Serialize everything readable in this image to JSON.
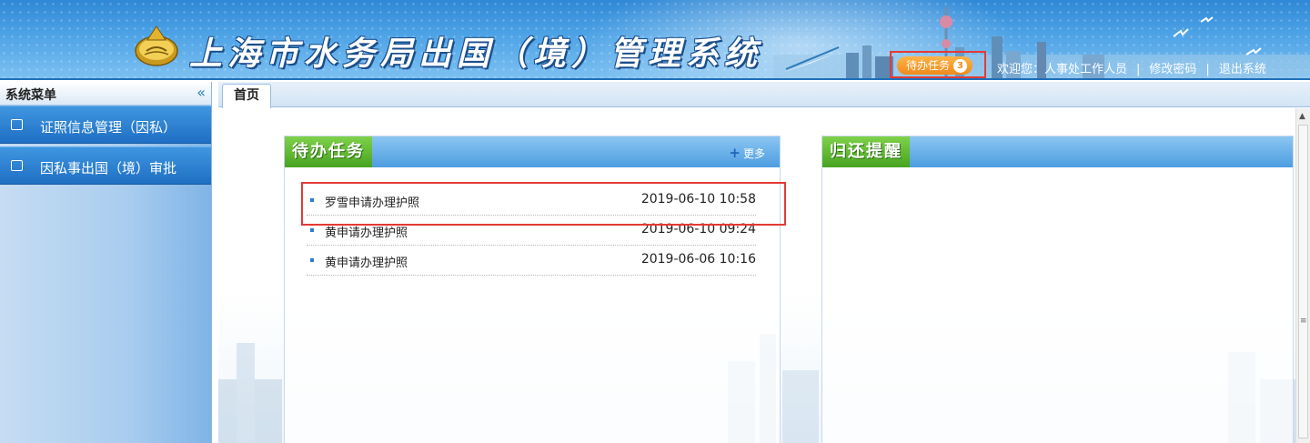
{
  "header": {
    "system_title": "上海市水务局出国（境）管理系统",
    "todo_badge_label": "待办任务",
    "todo_count": "3",
    "welcome_text": "欢迎您：人事处工作人员",
    "separator": "|",
    "change_password": "修改密码",
    "logout": "退出系统",
    "accent_color": "#2f88d6"
  },
  "sidebar": {
    "title": "系统菜单",
    "collapse_glyph": "«",
    "items": [
      {
        "label": "证照信息管理（因私）",
        "icon": "image-icon"
      },
      {
        "label": "因私事出国（境）审批",
        "icon": "edit-icon"
      }
    ]
  },
  "tabs": [
    {
      "label": "首页"
    }
  ],
  "todo_panel": {
    "title": "待办任务",
    "more_label": "更多",
    "tasks": [
      {
        "name": "罗雪申请办理护照",
        "time": "2019-06-10 10:58"
      },
      {
        "name": "黄申请办理护照",
        "time": "2019-06-10 09:24"
      },
      {
        "name": "黄申请办理护照",
        "time": "2019-06-06 10:16"
      }
    ]
  },
  "return_panel": {
    "title": "归还提醒"
  }
}
